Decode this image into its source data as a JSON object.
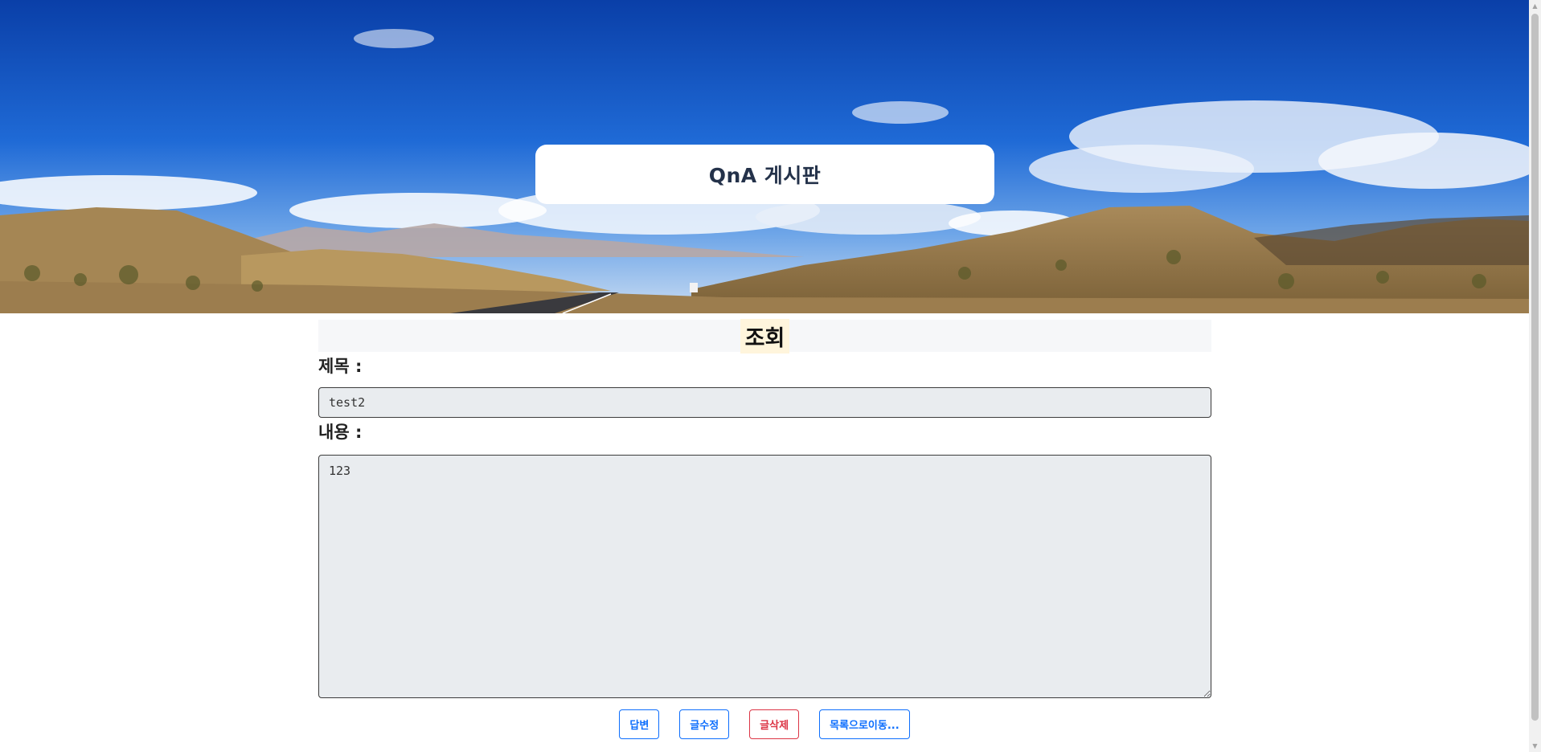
{
  "header": {
    "board_title": "QnA 게시판"
  },
  "view": {
    "section_title": "조회",
    "title_label": "제목 :",
    "title_value": "test2",
    "content_label": "내용 :",
    "content_value": "123"
  },
  "actions": {
    "reply_label": "답변",
    "edit_label": "글수정",
    "delete_label": "글삭제",
    "list_label": "목록으로이동..."
  },
  "colors": {
    "primary": "#0d6efd",
    "danger": "#dc3545",
    "sky": "#0a4fc4"
  }
}
